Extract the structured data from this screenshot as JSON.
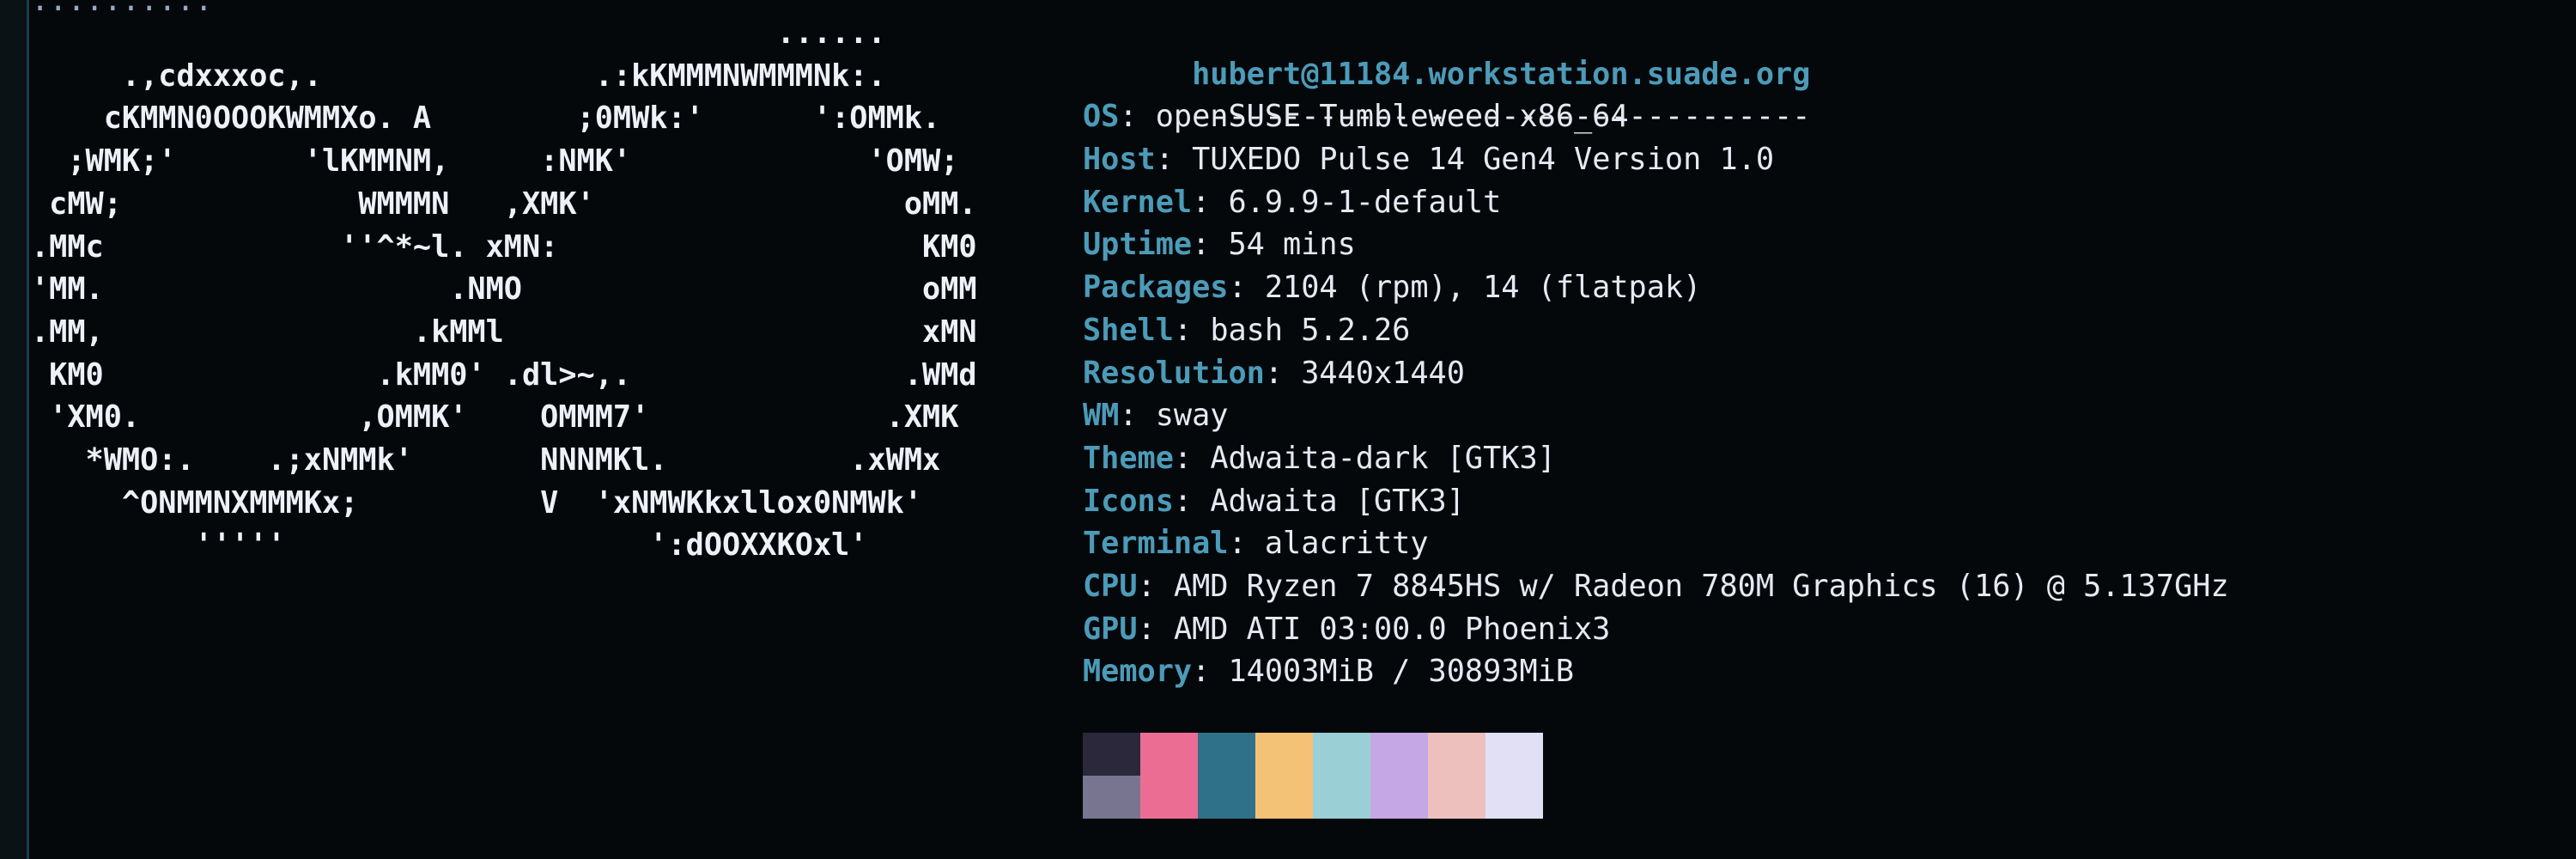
{
  "terminal": {
    "app": "alacritty",
    "top_fragment": "..........",
    "logo": {
      "lines": [
        "                                         ......",
        "     .,cdxxxoc,.               .:kKMMMNWMMMNk:.",
        "    cKMMN0OOOKWMMXo. A        ;0MWk:'      ':OMMk.",
        "  ;WMK;'       'lKMMNM,     :NMK'             'OMW;",
        " cMW;             WMMMN   ,XMK'                 oMM.",
        ".MMc             ''^*~l. xMN:                    KM0",
        "'MM.                   .NMO                      oMM",
        ".MM,                 .kMMl                       xMN",
        " KM0               .kMM0' .dl>~,.               .WMd",
        " 'XM0.            ,OMMK'    OMMM7'             .XMK",
        "   *WMO:.    .;xNMMk'       NNNMKl.          .xWMx",
        "     ^ONMMNXMMMKx;          V  'xNMWKkxllox0NMWk'",
        "         '''''                    ':dOOXXKOxl'"
      ]
    },
    "fetch": {
      "title": "hubert@11184.workstation.suade.org",
      "separator": "----------------------------------",
      "rows": [
        {
          "key": "OS",
          "value": "openSUSE Tumbleweed x86_64"
        },
        {
          "key": "Host",
          "value": "TUXEDO Pulse 14 Gen4 Version 1.0"
        },
        {
          "key": "Kernel",
          "value": "6.9.9-1-default"
        },
        {
          "key": "Uptime",
          "value": "54 mins"
        },
        {
          "key": "Packages",
          "value": "2104 (rpm), 14 (flatpak)"
        },
        {
          "key": "Shell",
          "value": "bash 5.2.26"
        },
        {
          "key": "Resolution",
          "value": "3440x1440"
        },
        {
          "key": "WM",
          "value": "sway"
        },
        {
          "key": "Theme",
          "value": "Adwaita-dark [GTK3]"
        },
        {
          "key": "Icons",
          "value": "Adwaita [GTK3]"
        },
        {
          "key": "Terminal",
          "value": "alacritty"
        },
        {
          "key": "CPU",
          "value": "AMD Ryzen 7 8845HS w/ Radeon 780M Graphics (16) @ 5.137GHz"
        },
        {
          "key": "GPU",
          "value": "AMD ATI 03:00.0 Phoenix3"
        },
        {
          "key": "Memory",
          "value": "14003MiB / 30893MiB"
        }
      ]
    },
    "palette": {
      "columns": [
        {
          "top": "#2c283b",
          "bottom": "#787591"
        },
        {
          "top": "#ec6d93",
          "bottom": "#ec6d93"
        },
        {
          "top": "#2f7189",
          "bottom": "#2f7189"
        },
        {
          "top": "#f4c276",
          "bottom": "#f4c276"
        },
        {
          "top": "#9bcfd6",
          "bottom": "#9bcfd6"
        },
        {
          "top": "#c5a7e6",
          "bottom": "#c5a7e6"
        },
        {
          "top": "#eec0bd",
          "bottom": "#eec0bd"
        },
        {
          "top": "#e1e0f4",
          "bottom": "#e1e0f4"
        }
      ]
    },
    "colors": {
      "background": "#05080b",
      "key": "#4c9bb8",
      "text": "#e6e9f1",
      "logo": "#eef1f8"
    }
  }
}
